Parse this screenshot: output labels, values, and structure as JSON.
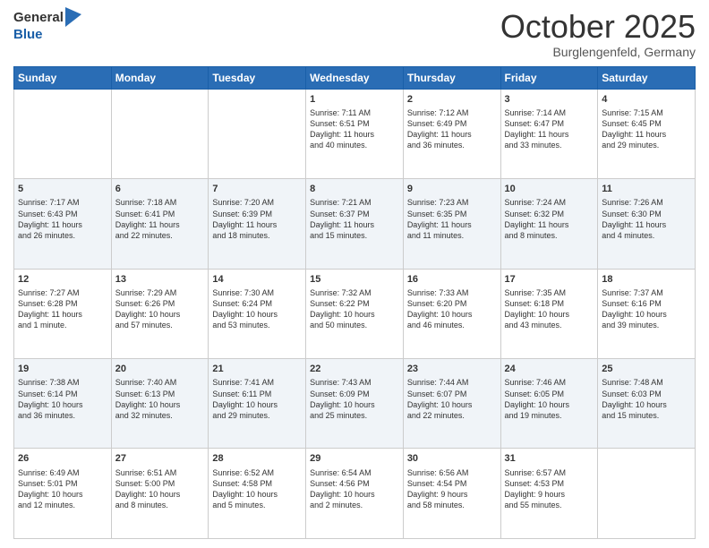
{
  "header": {
    "logo_general": "General",
    "logo_blue": "Blue",
    "month": "October 2025",
    "location": "Burglengenfeld, Germany"
  },
  "days_of_week": [
    "Sunday",
    "Monday",
    "Tuesday",
    "Wednesday",
    "Thursday",
    "Friday",
    "Saturday"
  ],
  "weeks": [
    [
      {
        "day": "",
        "info": ""
      },
      {
        "day": "",
        "info": ""
      },
      {
        "day": "",
        "info": ""
      },
      {
        "day": "1",
        "info": "Sunrise: 7:11 AM\nSunset: 6:51 PM\nDaylight: 11 hours\nand 40 minutes."
      },
      {
        "day": "2",
        "info": "Sunrise: 7:12 AM\nSunset: 6:49 PM\nDaylight: 11 hours\nand 36 minutes."
      },
      {
        "day": "3",
        "info": "Sunrise: 7:14 AM\nSunset: 6:47 PM\nDaylight: 11 hours\nand 33 minutes."
      },
      {
        "day": "4",
        "info": "Sunrise: 7:15 AM\nSunset: 6:45 PM\nDaylight: 11 hours\nand 29 minutes."
      }
    ],
    [
      {
        "day": "5",
        "info": "Sunrise: 7:17 AM\nSunset: 6:43 PM\nDaylight: 11 hours\nand 26 minutes."
      },
      {
        "day": "6",
        "info": "Sunrise: 7:18 AM\nSunset: 6:41 PM\nDaylight: 11 hours\nand 22 minutes."
      },
      {
        "day": "7",
        "info": "Sunrise: 7:20 AM\nSunset: 6:39 PM\nDaylight: 11 hours\nand 18 minutes."
      },
      {
        "day": "8",
        "info": "Sunrise: 7:21 AM\nSunset: 6:37 PM\nDaylight: 11 hours\nand 15 minutes."
      },
      {
        "day": "9",
        "info": "Sunrise: 7:23 AM\nSunset: 6:35 PM\nDaylight: 11 hours\nand 11 minutes."
      },
      {
        "day": "10",
        "info": "Sunrise: 7:24 AM\nSunset: 6:32 PM\nDaylight: 11 hours\nand 8 minutes."
      },
      {
        "day": "11",
        "info": "Sunrise: 7:26 AM\nSunset: 6:30 PM\nDaylight: 11 hours\nand 4 minutes."
      }
    ],
    [
      {
        "day": "12",
        "info": "Sunrise: 7:27 AM\nSunset: 6:28 PM\nDaylight: 11 hours\nand 1 minute."
      },
      {
        "day": "13",
        "info": "Sunrise: 7:29 AM\nSunset: 6:26 PM\nDaylight: 10 hours\nand 57 minutes."
      },
      {
        "day": "14",
        "info": "Sunrise: 7:30 AM\nSunset: 6:24 PM\nDaylight: 10 hours\nand 53 minutes."
      },
      {
        "day": "15",
        "info": "Sunrise: 7:32 AM\nSunset: 6:22 PM\nDaylight: 10 hours\nand 50 minutes."
      },
      {
        "day": "16",
        "info": "Sunrise: 7:33 AM\nSunset: 6:20 PM\nDaylight: 10 hours\nand 46 minutes."
      },
      {
        "day": "17",
        "info": "Sunrise: 7:35 AM\nSunset: 6:18 PM\nDaylight: 10 hours\nand 43 minutes."
      },
      {
        "day": "18",
        "info": "Sunrise: 7:37 AM\nSunset: 6:16 PM\nDaylight: 10 hours\nand 39 minutes."
      }
    ],
    [
      {
        "day": "19",
        "info": "Sunrise: 7:38 AM\nSunset: 6:14 PM\nDaylight: 10 hours\nand 36 minutes."
      },
      {
        "day": "20",
        "info": "Sunrise: 7:40 AM\nSunset: 6:13 PM\nDaylight: 10 hours\nand 32 minutes."
      },
      {
        "day": "21",
        "info": "Sunrise: 7:41 AM\nSunset: 6:11 PM\nDaylight: 10 hours\nand 29 minutes."
      },
      {
        "day": "22",
        "info": "Sunrise: 7:43 AM\nSunset: 6:09 PM\nDaylight: 10 hours\nand 25 minutes."
      },
      {
        "day": "23",
        "info": "Sunrise: 7:44 AM\nSunset: 6:07 PM\nDaylight: 10 hours\nand 22 minutes."
      },
      {
        "day": "24",
        "info": "Sunrise: 7:46 AM\nSunset: 6:05 PM\nDaylight: 10 hours\nand 19 minutes."
      },
      {
        "day": "25",
        "info": "Sunrise: 7:48 AM\nSunset: 6:03 PM\nDaylight: 10 hours\nand 15 minutes."
      }
    ],
    [
      {
        "day": "26",
        "info": "Sunrise: 6:49 AM\nSunset: 5:01 PM\nDaylight: 10 hours\nand 12 minutes."
      },
      {
        "day": "27",
        "info": "Sunrise: 6:51 AM\nSunset: 5:00 PM\nDaylight: 10 hours\nand 8 minutes."
      },
      {
        "day": "28",
        "info": "Sunrise: 6:52 AM\nSunset: 4:58 PM\nDaylight: 10 hours\nand 5 minutes."
      },
      {
        "day": "29",
        "info": "Sunrise: 6:54 AM\nSunset: 4:56 PM\nDaylight: 10 hours\nand 2 minutes."
      },
      {
        "day": "30",
        "info": "Sunrise: 6:56 AM\nSunset: 4:54 PM\nDaylight: 9 hours\nand 58 minutes."
      },
      {
        "day": "31",
        "info": "Sunrise: 6:57 AM\nSunset: 4:53 PM\nDaylight: 9 hours\nand 55 minutes."
      },
      {
        "day": "",
        "info": ""
      }
    ]
  ]
}
